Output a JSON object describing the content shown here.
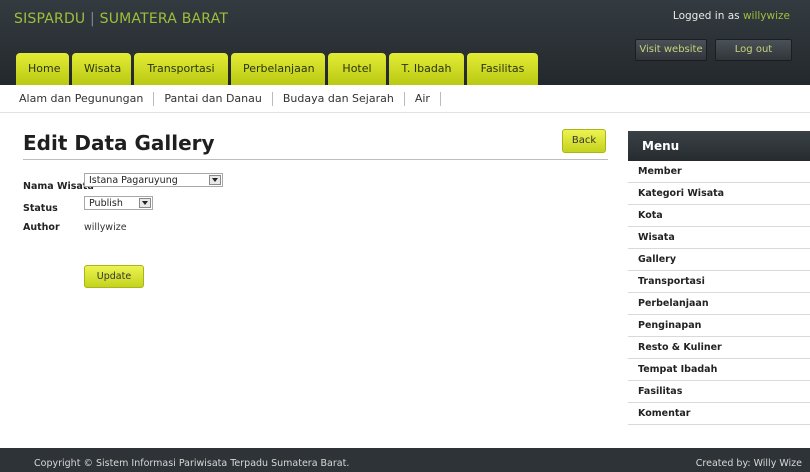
{
  "header": {
    "brand_part1": "SISPARDU",
    "brand_sep": " | ",
    "brand_part2": "SUMATERA BARAT",
    "logged_in_prefix": "Logged in as ",
    "username": "willywize",
    "visit_label": "Visit website",
    "logout_label": "Log out"
  },
  "nav": {
    "tabs": [
      {
        "label": "Home"
      },
      {
        "label": "Wisata"
      },
      {
        "label": "Transportasi"
      },
      {
        "label": "Perbelanjaan"
      },
      {
        "label": "Hotel"
      },
      {
        "label": "T. Ibadah"
      },
      {
        "label": "Fasilitas"
      }
    ]
  },
  "subnav": {
    "items": [
      {
        "label": "Alam dan Pegunungan"
      },
      {
        "label": "Pantai dan Danau"
      },
      {
        "label": "Budaya dan Sejarah"
      },
      {
        "label": "Air"
      }
    ]
  },
  "main": {
    "title": "Edit Data Gallery",
    "back_label": "Back",
    "form": {
      "nama_wisata_label": "Nama Wisata",
      "nama_wisata_value": "Istana Pagaruyung",
      "status_label": "Status",
      "status_value": "Publish",
      "author_label": "Author",
      "author_value": "willywize",
      "update_label": "Update"
    }
  },
  "sidebar": {
    "title": "Menu",
    "items": [
      {
        "label": "Member"
      },
      {
        "label": "Kategori Wisata"
      },
      {
        "label": "Kota"
      },
      {
        "label": "Wisata"
      },
      {
        "label": "Gallery"
      },
      {
        "label": "Transportasi"
      },
      {
        "label": "Perbelanjaan"
      },
      {
        "label": "Penginapan"
      },
      {
        "label": "Resto & Kuliner"
      },
      {
        "label": "Tempat Ibadah"
      },
      {
        "label": "Fasilitas"
      },
      {
        "label": "Komentar"
      }
    ]
  },
  "footer": {
    "copyright": "Copyright © Sistem Informasi Pariwisata Terpadu Sumatera Barat.",
    "credit": "Created by: Willy Wize"
  },
  "colors": {
    "accent_yellow": "#d8e224",
    "header_dark": "#2b3135",
    "brand_green": "#9fbf3a"
  }
}
